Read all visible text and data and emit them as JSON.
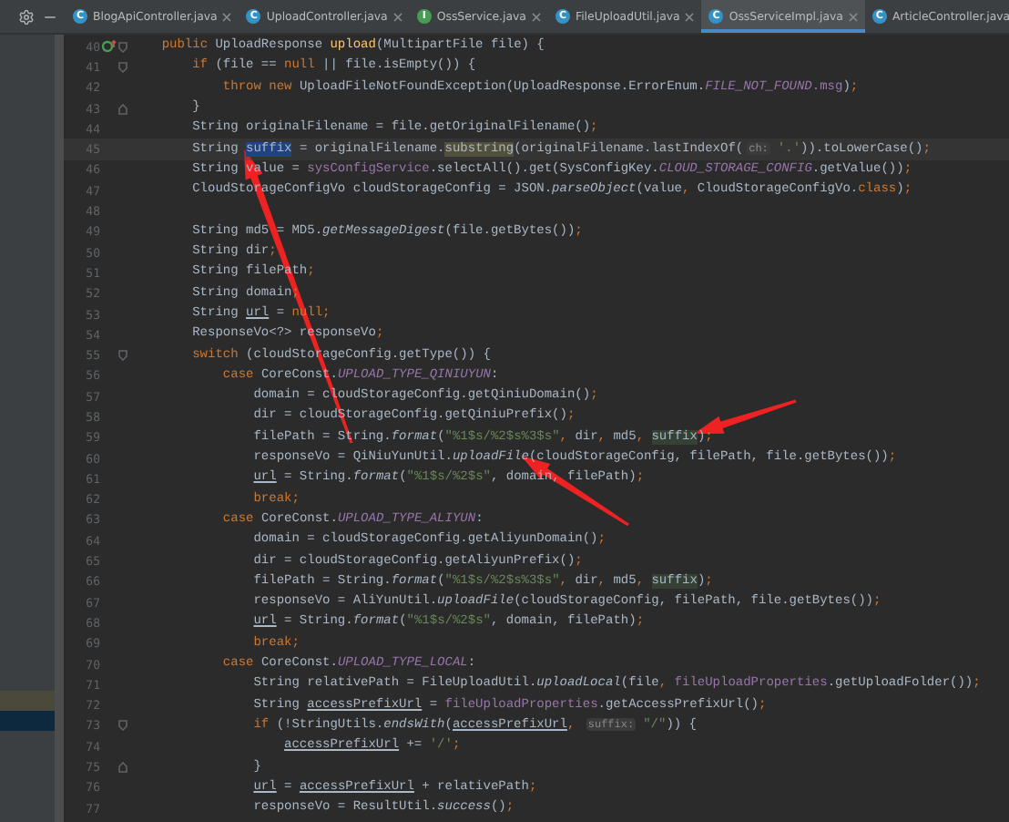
{
  "tabs": [
    {
      "label": "BlogApiController.java",
      "badge": "C",
      "kind": "class",
      "selected": false
    },
    {
      "label": "UploadController.java",
      "badge": "C",
      "kind": "class",
      "selected": false
    },
    {
      "label": "OssService.java",
      "badge": "I",
      "kind": "interface",
      "selected": false
    },
    {
      "label": "FileUploadUtil.java",
      "badge": "C",
      "kind": "class",
      "selected": false
    },
    {
      "label": "OssServiceImpl.java",
      "badge": "C",
      "kind": "class",
      "selected": true
    },
    {
      "label": "ArticleController.java",
      "badge": "C",
      "kind": "class",
      "selected": false
    }
  ],
  "side_panel": {
    "rows": [
      {
        "selected": false
      },
      {
        "selected": true
      }
    ]
  },
  "lines": [
    {
      "number": "40",
      "overridden": true,
      "fold_start": true,
      "tokens": [
        {
          "text": "    public ",
          "kind": "kw"
        },
        {
          "text": "UploadResponse "
        },
        {
          "text": "upload",
          "kind": "fn"
        },
        {
          "text": "(MultipartFile file) {"
        }
      ]
    },
    {
      "number": "41",
      "fold_start": true,
      "tokens": [
        {
          "text": "        if ",
          "kind": "kw"
        },
        {
          "text": "(file == "
        },
        {
          "text": "null ",
          "kind": "kw"
        },
        {
          "text": "|| file.isEmpty()) {"
        }
      ]
    },
    {
      "number": "42",
      "tokens": [
        {
          "text": "            throw new ",
          "kind": "kw"
        },
        {
          "text": "UploadFileNotFoundException(UploadResponse.ErrorEnum."
        },
        {
          "text": "FILE_NOT_FOUND",
          "kind": "const"
        },
        {
          "text": ".msg",
          "kind": "field"
        },
        {
          "text": ")"
        },
        {
          "text": ";",
          "kind": "kw"
        }
      ]
    },
    {
      "number": "43",
      "fold_end": true,
      "tokens": [
        {
          "text": "        }"
        }
      ]
    },
    {
      "number": "44",
      "tokens": [
        {
          "text": "        String originalFilename = file.getOriginalFilename()"
        },
        {
          "text": ";",
          "kind": "kw"
        }
      ]
    },
    {
      "number": "45",
      "current": true,
      "tokens": [
        {
          "text": "        String "
        },
        {
          "text": "suffix",
          "kind": "sel"
        },
        {
          "text": " = originalFilename."
        },
        {
          "text": "substring",
          "kind": "match"
        },
        {
          "text": "(originalFilename.lastIndexOf("
        },
        {
          "text": "ch:",
          "kind": "hint"
        },
        {
          "text": "'.'",
          "kind": "str"
        },
        {
          "text": ")).toLowerCase()"
        },
        {
          "text": ";",
          "kind": "kw"
        }
      ]
    },
    {
      "number": "46",
      "tokens": [
        {
          "text": "        String value = "
        },
        {
          "text": "sysConfigService",
          "kind": "field"
        },
        {
          "text": ".selectAll().get(SysConfigKey."
        },
        {
          "text": "CLOUD_STORAGE_CONFIG",
          "kind": "const"
        },
        {
          "text": ".getValue())"
        },
        {
          "text": ";",
          "kind": "kw"
        }
      ]
    },
    {
      "number": "47",
      "tokens": [
        {
          "text": "        CloudStorageConfigVo cloudStorageConfig = JSON."
        },
        {
          "text": "parseObject",
          "kind": "static"
        },
        {
          "text": "(value"
        },
        {
          "text": ", ",
          "kind": "kw"
        },
        {
          "text": "CloudStorageConfigVo."
        },
        {
          "text": "class",
          "kind": "kw"
        },
        {
          "text": ")"
        },
        {
          "text": ";",
          "kind": "kw"
        }
      ]
    },
    {
      "number": "48"
    },
    {
      "number": "49",
      "tokens": [
        {
          "text": "        String md5 = MD5."
        },
        {
          "text": "getMessageDigest",
          "kind": "static"
        },
        {
          "text": "(file.getBytes())"
        },
        {
          "text": ";",
          "kind": "kw"
        }
      ]
    },
    {
      "number": "50",
      "tokens": [
        {
          "text": "        String dir"
        },
        {
          "text": ";",
          "kind": "kw"
        }
      ]
    },
    {
      "number": "51",
      "tokens": [
        {
          "text": "        String filePath"
        },
        {
          "text": ";",
          "kind": "kw"
        }
      ]
    },
    {
      "number": "52",
      "tokens": [
        {
          "text": "        String domain"
        },
        {
          "text": ";",
          "kind": "kw"
        }
      ]
    },
    {
      "number": "53",
      "tokens": [
        {
          "text": "        String "
        },
        {
          "text": "url",
          "kind": "ul"
        },
        {
          "text": " = "
        },
        {
          "text": "null;",
          "kind": "kw"
        }
      ]
    },
    {
      "number": "54",
      "tokens": [
        {
          "text": "        ResponseVo<?> responseVo"
        },
        {
          "text": ";",
          "kind": "kw"
        }
      ]
    },
    {
      "number": "55",
      "fold_start": true,
      "tokens": [
        {
          "text": "        switch ",
          "kind": "kw"
        },
        {
          "text": "(cloudStorageConfig.getType()) {"
        }
      ]
    },
    {
      "number": "56",
      "tokens": [
        {
          "text": "            case ",
          "kind": "kw"
        },
        {
          "text": "CoreConst."
        },
        {
          "text": "UPLOAD_TYPE_QINIUYUN",
          "kind": "const"
        },
        {
          "text": ":"
        }
      ]
    },
    {
      "number": "57",
      "tokens": [
        {
          "text": "                domain = cloudStorageConfig.getQiniuDomain()"
        },
        {
          "text": ";",
          "kind": "kw"
        }
      ]
    },
    {
      "number": "58",
      "tokens": [
        {
          "text": "                dir = cloudStorageConfig.getQiniuPrefix()"
        },
        {
          "text": ";",
          "kind": "kw"
        }
      ]
    },
    {
      "number": "59",
      "tokens": [
        {
          "text": "                filePath = String."
        },
        {
          "text": "format",
          "kind": "static"
        },
        {
          "text": "("
        },
        {
          "text": "\"%1$s/%2$s%3$s\"",
          "kind": "str"
        },
        {
          "text": ", ",
          "kind": "kw"
        },
        {
          "text": "dir"
        },
        {
          "text": ", ",
          "kind": "kw"
        },
        {
          "text": "md5"
        },
        {
          "text": ", ",
          "kind": "kw"
        },
        {
          "text": "suffix",
          "kind": "usage"
        },
        {
          "text": ")"
        },
        {
          "text": ";",
          "kind": "kw"
        }
      ]
    },
    {
      "number": "60",
      "tokens": [
        {
          "text": "                responseVo = QiNiuYunUtil."
        },
        {
          "text": "uploadFile",
          "kind": "static"
        },
        {
          "text": "(cloudStorageConfig, filePath, file.getBytes())"
        },
        {
          "text": ";",
          "kind": "kw"
        }
      ]
    },
    {
      "number": "61",
      "tokens": [
        {
          "text": "                url",
          "kind": "ul"
        },
        {
          "text": " = String."
        },
        {
          "text": "format",
          "kind": "static"
        },
        {
          "text": "("
        },
        {
          "text": "\"%1$s/%2$s\"",
          "kind": "str"
        },
        {
          "text": ", domain, filePath)"
        },
        {
          "text": ";",
          "kind": "kw"
        }
      ]
    },
    {
      "number": "62",
      "tokens": [
        {
          "text": "                break;",
          "kind": "kw"
        }
      ]
    },
    {
      "number": "63",
      "tokens": [
        {
          "text": "            case ",
          "kind": "kw"
        },
        {
          "text": "CoreConst."
        },
        {
          "text": "UPLOAD_TYPE_ALIYUN",
          "kind": "const"
        },
        {
          "text": ":"
        }
      ]
    },
    {
      "number": "64",
      "tokens": [
        {
          "text": "                domain = cloudStorageConfig.getAliyunDomain()"
        },
        {
          "text": ";",
          "kind": "kw"
        }
      ]
    },
    {
      "number": "65",
      "tokens": [
        {
          "text": "                dir = cloudStorageConfig.getAliyunPrefix()"
        },
        {
          "text": ";",
          "kind": "kw"
        }
      ]
    },
    {
      "number": "66",
      "tokens": [
        {
          "text": "                filePath = String."
        },
        {
          "text": "format",
          "kind": "static"
        },
        {
          "text": "("
        },
        {
          "text": "\"%1$s/%2$s%3$s\"",
          "kind": "str"
        },
        {
          "text": ", ",
          "kind": "kw"
        },
        {
          "text": "dir"
        },
        {
          "text": ", ",
          "kind": "kw"
        },
        {
          "text": "md5"
        },
        {
          "text": ", ",
          "kind": "kw"
        },
        {
          "text": "suffix",
          "kind": "usage"
        },
        {
          "text": ")"
        },
        {
          "text": ";",
          "kind": "kw"
        }
      ]
    },
    {
      "number": "67",
      "tokens": [
        {
          "text": "                responseVo = AliYunUtil."
        },
        {
          "text": "uploadFile",
          "kind": "static"
        },
        {
          "text": "(cloudStorageConfig, filePath, file.getBytes())"
        },
        {
          "text": ";",
          "kind": "kw"
        }
      ]
    },
    {
      "number": "68",
      "tokens": [
        {
          "text": "                url",
          "kind": "ul"
        },
        {
          "text": " = String."
        },
        {
          "text": "format",
          "kind": "static"
        },
        {
          "text": "("
        },
        {
          "text": "\"%1$s/%2$s\"",
          "kind": "str"
        },
        {
          "text": ", domain, filePath)"
        },
        {
          "text": ";",
          "kind": "kw"
        }
      ]
    },
    {
      "number": "69",
      "tokens": [
        {
          "text": "                break;",
          "kind": "kw"
        }
      ]
    },
    {
      "number": "70",
      "tokens": [
        {
          "text": "            case ",
          "kind": "kw"
        },
        {
          "text": "CoreConst."
        },
        {
          "text": "UPLOAD_TYPE_LOCAL",
          "kind": "const"
        },
        {
          "text": ":"
        }
      ]
    },
    {
      "number": "71",
      "tokens": [
        {
          "text": "                String relativePath = FileUploadUtil."
        },
        {
          "text": "uploadLocal",
          "kind": "static"
        },
        {
          "text": "(file"
        },
        {
          "text": ", ",
          "kind": "kw"
        },
        {
          "text": "fileUploadProperties",
          "kind": "field"
        },
        {
          "text": ".getUploadFolder())"
        },
        {
          "text": ";",
          "kind": "kw"
        }
      ]
    },
    {
      "number": "72",
      "tokens": [
        {
          "text": "                String "
        },
        {
          "text": "accessPrefixUrl",
          "kind": "ul"
        },
        {
          "text": " = "
        },
        {
          "text": "fileUploadProperties",
          "kind": "field"
        },
        {
          "text": ".getAccessPrefixUrl()"
        },
        {
          "text": ";",
          "kind": "kw"
        }
      ]
    },
    {
      "number": "73",
      "fold_start": true,
      "tokens": [
        {
          "text": "                if ",
          "kind": "kw"
        },
        {
          "text": "(!StringUtils."
        },
        {
          "text": "endsWith",
          "kind": "static"
        },
        {
          "text": "("
        },
        {
          "text": "accessPrefixUrl",
          "kind": "ul"
        },
        {
          "text": ", ",
          "kind": "kw"
        },
        {
          "text": "suffix:",
          "kind": "hint"
        },
        {
          "text": "\"/\"",
          "kind": "str"
        },
        {
          "text": ")) {"
        }
      ]
    },
    {
      "number": "74",
      "tokens": [
        {
          "text": "                    accessPrefixUrl",
          "kind": "ul"
        },
        {
          "text": " += "
        },
        {
          "text": "'/'",
          "kind": "str"
        },
        {
          "text": ";",
          "kind": "kw"
        }
      ]
    },
    {
      "number": "75",
      "fold_end": true,
      "tokens": [
        {
          "text": "                }"
        }
      ]
    },
    {
      "number": "76",
      "tokens": [
        {
          "text": "                url",
          "kind": "ul"
        },
        {
          "text": " = "
        },
        {
          "text": "accessPrefixUrl",
          "kind": "ul"
        },
        {
          "text": " + relativePath"
        },
        {
          "text": ";",
          "kind": "kw"
        }
      ]
    },
    {
      "number": "77",
      "tokens": [
        {
          "text": "                responseVo = ResultUtil."
        },
        {
          "text": "success",
          "kind": "static"
        },
        {
          "text": "()"
        },
        {
          "text": ";",
          "kind": "kw"
        }
      ]
    }
  ]
}
